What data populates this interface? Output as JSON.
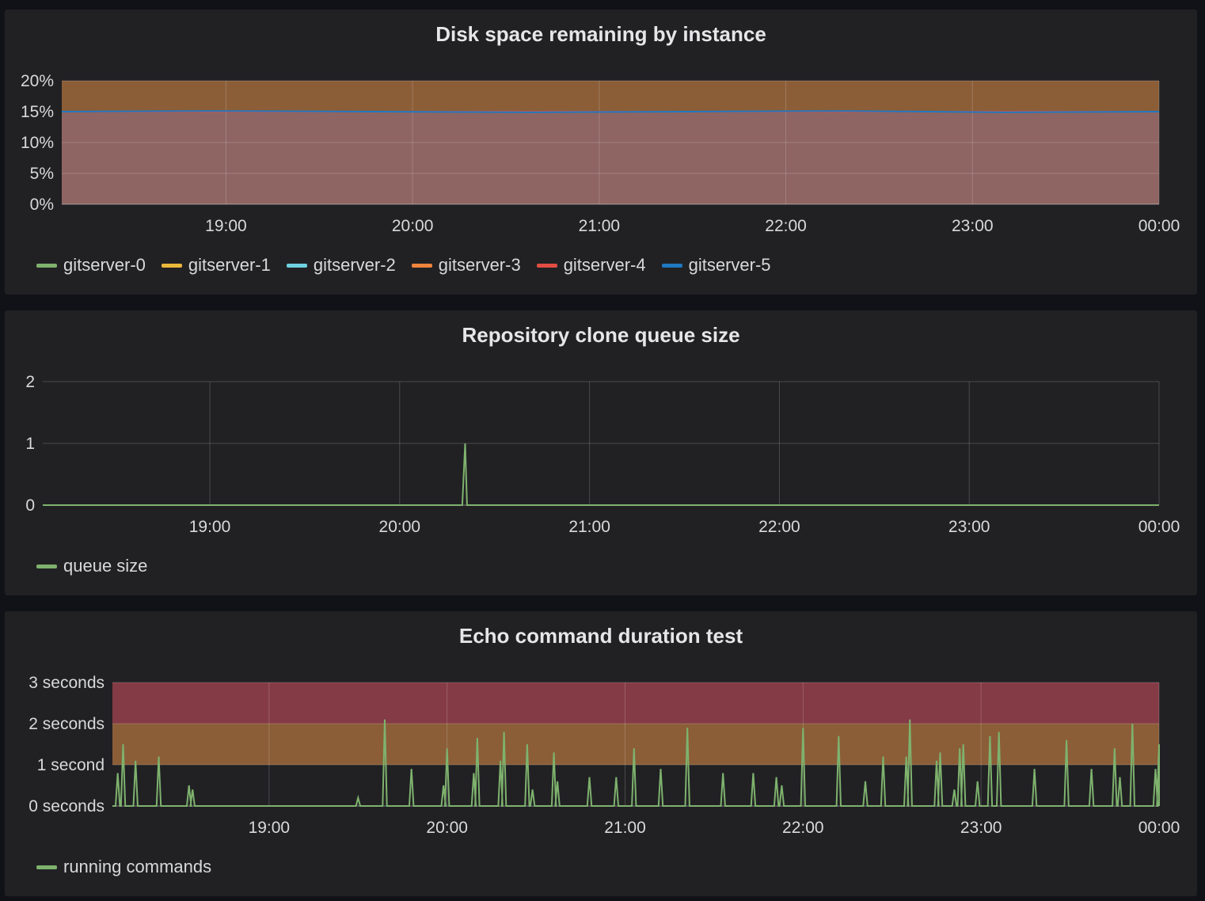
{
  "panels": [
    {
      "title": "Disk space remaining by instance",
      "legend": [
        {
          "label": "gitserver-0",
          "color": "#7eb26d"
        },
        {
          "label": "gitserver-1",
          "color": "#eab839"
        },
        {
          "label": "gitserver-2",
          "color": "#6ed0e0"
        },
        {
          "label": "gitserver-3",
          "color": "#ef843c"
        },
        {
          "label": "gitserver-4",
          "color": "#e24d42"
        },
        {
          "label": "gitserver-5",
          "color": "#1f78c1"
        }
      ]
    },
    {
      "title": "Repository clone queue size",
      "legend": [
        {
          "label": "queue size",
          "color": "#7eb26d"
        }
      ]
    },
    {
      "title": "Echo command duration test",
      "legend": [
        {
          "label": "running commands",
          "color": "#7eb26d"
        }
      ]
    }
  ],
  "chart_data": [
    {
      "type": "area",
      "title": "Disk space remaining by instance",
      "x_ticks": [
        "19:00",
        "20:00",
        "21:00",
        "22:00",
        "23:00",
        "00:00"
      ],
      "y_ticks": [
        "20%",
        "15%",
        "10%",
        "5%",
        "0%"
      ],
      "y_tick_values": [
        20,
        15,
        10,
        5,
        0
      ],
      "ylim": [
        0,
        20
      ],
      "xlim_hours": [
        18.12,
        24.0
      ],
      "thresholds": [
        {
          "from": 0,
          "to": 15,
          "color": "#8e6562"
        },
        {
          "from": 15,
          "to": 20,
          "color": "#8b5e38"
        }
      ],
      "series": [
        {
          "name": "gitserver-0",
          "values": [
            15.0,
            15.0,
            15.0,
            15.0,
            15.0,
            15.0,
            15.0,
            15.0
          ]
        },
        {
          "name": "gitserver-1",
          "values": [
            15.0,
            15.0,
            15.0,
            15.0,
            15.0,
            15.0,
            15.0,
            15.0
          ]
        },
        {
          "name": "gitserver-2",
          "values": [
            15.0,
            15.0,
            15.0,
            15.0,
            15.0,
            15.0,
            15.0,
            15.0
          ]
        },
        {
          "name": "gitserver-3",
          "values": [
            15.0,
            15.0,
            15.0,
            15.0,
            15.0,
            15.0,
            15.0,
            15.0
          ]
        },
        {
          "name": "gitserver-4",
          "values": [
            15.0,
            15.0,
            15.0,
            15.0,
            15.0,
            15.0,
            15.0,
            15.0
          ]
        },
        {
          "name": "gitserver-5",
          "values": [
            15.0,
            15.1,
            15.0,
            14.9,
            15.0,
            15.1,
            14.9,
            15.0
          ]
        }
      ]
    },
    {
      "type": "line",
      "title": "Repository clone queue size",
      "x_ticks": [
        "19:00",
        "20:00",
        "21:00",
        "22:00",
        "23:00",
        "00:00"
      ],
      "y_ticks": [
        "2",
        "1",
        "0"
      ],
      "y_tick_values": [
        2,
        1,
        0
      ],
      "ylim": [
        0,
        2
      ],
      "xlim_hours": [
        18.12,
        24.0
      ],
      "series": [
        {
          "name": "queue size",
          "x": [
            18.12,
            20.33,
            20.345,
            20.355,
            20.37,
            24.0
          ],
          "y": [
            0,
            0,
            1,
            0,
            0,
            0
          ]
        }
      ]
    },
    {
      "type": "line",
      "title": "Echo command duration test",
      "x_ticks": [
        "19:00",
        "20:00",
        "21:00",
        "22:00",
        "23:00",
        "00:00"
      ],
      "y_ticks": [
        "3 seconds",
        "2 seconds",
        "1 second",
        "0 seconds"
      ],
      "y_tick_values": [
        3,
        2,
        1,
        0
      ],
      "ylim": [
        0,
        3
      ],
      "xlim_hours": [
        18.12,
        24.0
      ],
      "thresholds": [
        {
          "from": 1,
          "to": 2,
          "color": "#8b5e38"
        },
        {
          "from": 2,
          "to": 3,
          "color": "#843b45"
        }
      ],
      "series": [
        {
          "name": "running commands",
          "spikes": [
            [
              18.15,
              0.8
            ],
            [
              18.18,
              1.5
            ],
            [
              18.25,
              1.1
            ],
            [
              18.38,
              1.2
            ],
            [
              18.55,
              0.5
            ],
            [
              18.57,
              0.4
            ],
            [
              19.5,
              0.2
            ],
            [
              19.65,
              2.1
            ],
            [
              19.8,
              0.9
            ],
            [
              19.98,
              0.5
            ],
            [
              20.0,
              1.4
            ],
            [
              20.15,
              0.8
            ],
            [
              20.17,
              1.65
            ],
            [
              20.3,
              1.1
            ],
            [
              20.32,
              1.8
            ],
            [
              20.45,
              1.5
            ],
            [
              20.48,
              0.4
            ],
            [
              20.6,
              1.3
            ],
            [
              20.62,
              0.6
            ],
            [
              20.8,
              0.7
            ],
            [
              20.95,
              0.7
            ],
            [
              21.05,
              1.4
            ],
            [
              21.2,
              0.9
            ],
            [
              21.35,
              1.9
            ],
            [
              21.55,
              0.8
            ],
            [
              21.72,
              0.8
            ],
            [
              21.85,
              0.7
            ],
            [
              21.88,
              0.5
            ],
            [
              22.0,
              1.9
            ],
            [
              22.2,
              1.7
            ],
            [
              22.35,
              0.6
            ],
            [
              22.45,
              1.2
            ],
            [
              22.58,
              1.2
            ],
            [
              22.6,
              2.1
            ],
            [
              22.75,
              1.1
            ],
            [
              22.77,
              1.3
            ],
            [
              22.85,
              0.4
            ],
            [
              22.88,
              1.4
            ],
            [
              22.9,
              1.5
            ],
            [
              22.98,
              0.6
            ],
            [
              23.05,
              1.7
            ],
            [
              23.1,
              1.8
            ],
            [
              23.3,
              0.9
            ],
            [
              23.48,
              1.6
            ],
            [
              23.62,
              0.9
            ],
            [
              23.75,
              1.4
            ],
            [
              23.78,
              0.7
            ],
            [
              23.85,
              2.0
            ],
            [
              23.98,
              0.9
            ],
            [
              24.0,
              1.5
            ]
          ]
        }
      ]
    }
  ]
}
